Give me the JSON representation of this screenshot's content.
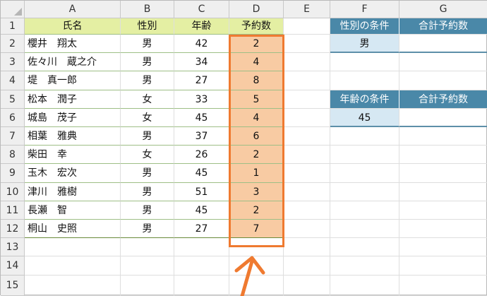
{
  "columns": [
    "A",
    "B",
    "C",
    "D",
    "E",
    "F",
    "G"
  ],
  "rows": [
    "1",
    "2",
    "3",
    "4",
    "5",
    "6",
    "7",
    "8",
    "9",
    "10",
    "11",
    "12",
    "13",
    "14",
    "15"
  ],
  "table": {
    "headers": [
      "氏名",
      "性別",
      "年齢",
      "予約数"
    ],
    "records": [
      [
        "櫻井　翔太",
        "男",
        "42",
        "2"
      ],
      [
        "佐々川　蔵之介",
        "男",
        "34",
        "4"
      ],
      [
        "堤　真一郎",
        "男",
        "27",
        "8"
      ],
      [
        "松本　潤子",
        "女",
        "33",
        "5"
      ],
      [
        "城島　茂子",
        "女",
        "45",
        "4"
      ],
      [
        "相葉　雅典",
        "男",
        "37",
        "6"
      ],
      [
        "柴田　幸",
        "女",
        "26",
        "2"
      ],
      [
        "玉木　宏次",
        "男",
        "45",
        "1"
      ],
      [
        "津川　雅樹",
        "男",
        "51",
        "3"
      ],
      [
        "長瀬　智",
        "男",
        "45",
        "2"
      ],
      [
        "桐山　史照",
        "男",
        "27",
        "7"
      ]
    ]
  },
  "gender_box": {
    "label": "性別の条件",
    "total_label": "合計予約数",
    "value": "男",
    "total": ""
  },
  "age_box": {
    "label": "年齢の条件",
    "total_label": "合計予約数",
    "value": "45",
    "total": ""
  },
  "colors": {
    "accent": "#ef7a30",
    "header_green": "#e4efa3",
    "header_blue": "#4a88a8",
    "highlight_fill": "#f8cba3"
  }
}
